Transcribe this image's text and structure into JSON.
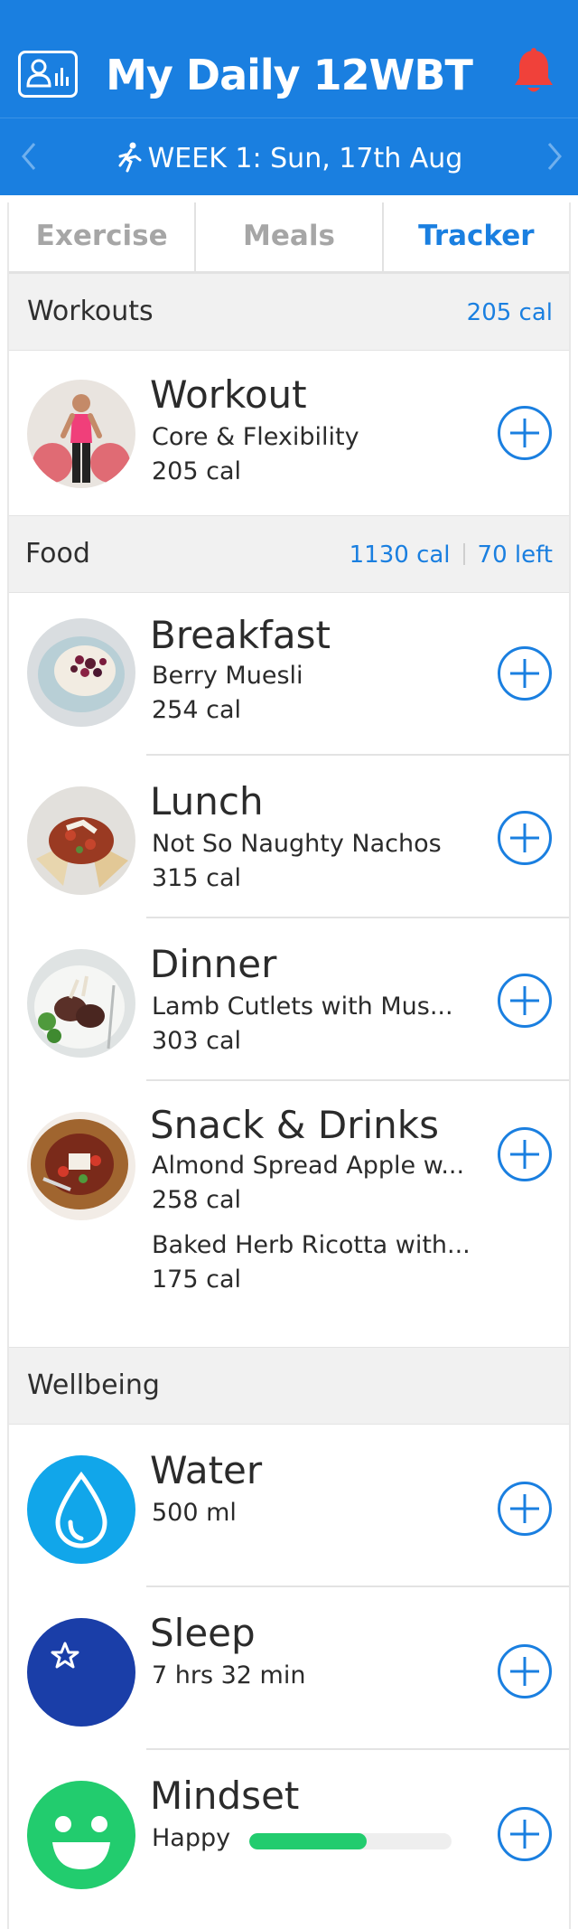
{
  "header": {
    "title": "My Daily 12WBT",
    "week_label": "WEEK 1: Sun, 17th Aug"
  },
  "tabs": [
    {
      "label": "Exercise",
      "active": false
    },
    {
      "label": "Meals",
      "active": false
    },
    {
      "label": "Tracker",
      "active": true
    }
  ],
  "workouts": {
    "title": "Workouts",
    "total": "205 cal",
    "item": {
      "title": "Workout",
      "subtitle": "Core & Flexibility",
      "cal": "205 cal"
    }
  },
  "food": {
    "title": "Food",
    "total": "1130 cal",
    "left": "70 left",
    "breakfast": {
      "title": "Breakfast",
      "subtitle": "Berry Muesli",
      "cal": "254 cal"
    },
    "lunch": {
      "title": "Lunch",
      "subtitle": "Not So Naughty Nachos",
      "cal": "315 cal"
    },
    "dinner": {
      "title": "Dinner",
      "subtitle": "Lamb Cutlets with Mus...",
      "cal": "303 cal"
    },
    "snacks": {
      "title": "Snack & Drinks",
      "item1": {
        "name": "Almond Spread Apple w...",
        "cal": "258 cal"
      },
      "item2": {
        "name": "Baked Herb Ricotta with...",
        "cal": "175 cal"
      }
    }
  },
  "wellbeing": {
    "title": "Wellbeing",
    "water": {
      "title": "Water",
      "value": "500 ml"
    },
    "sleep": {
      "title": "Sleep",
      "value": "7 hrs 32 min"
    },
    "mindset": {
      "title": "Mindset",
      "value": "Happy",
      "level": 0.58
    }
  },
  "colors": {
    "brand": "#1a7fe0",
    "bell": "#f0413a",
    "mood": "#22cc6e",
    "water": "#11a6ea",
    "sleep": "#1a3ea8"
  },
  "icons": {
    "profile": "profile-stats-icon",
    "bell": "notification-bell-icon",
    "runner": "runner-icon",
    "add": "add-circle-icon",
    "water": "water-drop-icon",
    "sleep": "moon-star-icon",
    "mindset": "smiley-icon"
  }
}
